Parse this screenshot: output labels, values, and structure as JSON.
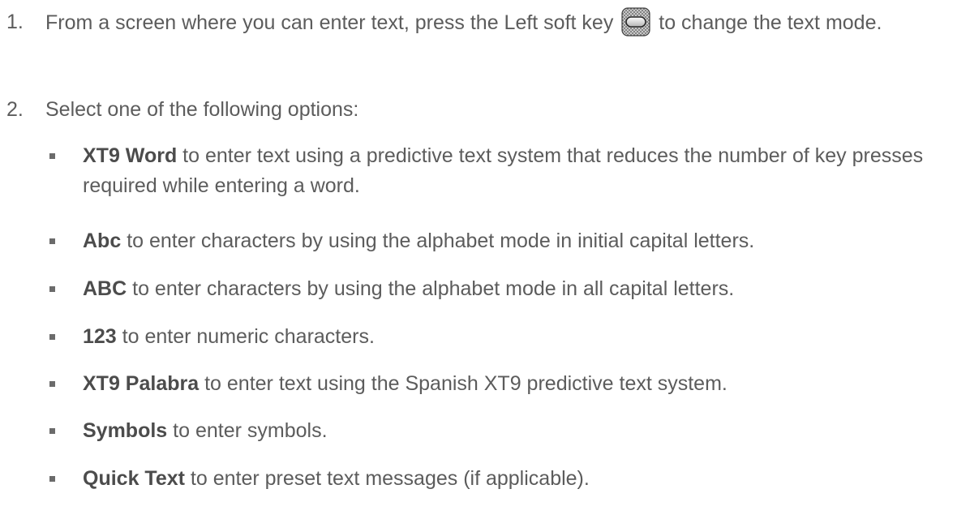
{
  "steps": [
    {
      "number": "1.",
      "text_before_icon": "From a screen where you can enter text, press the Left soft key",
      "icon": "left-soft-key-icon",
      "text_after_icon": "to change the text mode."
    },
    {
      "number": "2.",
      "text": "Select one of the following options:"
    }
  ],
  "options": [
    {
      "term": "XT9 Word",
      "description": "to enter text using a predictive text system that reduces the number of key presses required while entering a word."
    },
    {
      "term": "Abc",
      "description": "to enter characters by using the alphabet mode in initial capital letters."
    },
    {
      "term": "ABC",
      "description": "to enter characters by using the alphabet mode in all capital letters."
    },
    {
      "term": "123",
      "description": "to enter numeric characters."
    },
    {
      "term": "XT9 Palabra",
      "description": "to enter text using the Spanish XT9 predictive text system."
    },
    {
      "term": "Symbols",
      "description": "to enter symbols."
    },
    {
      "term": "Quick Text",
      "description": "to enter preset text messages (if applicable)."
    }
  ],
  "colors": {
    "text": "#5c5c5c",
    "term": "#4c4c4c",
    "bullet": "#6b6b6b"
  }
}
